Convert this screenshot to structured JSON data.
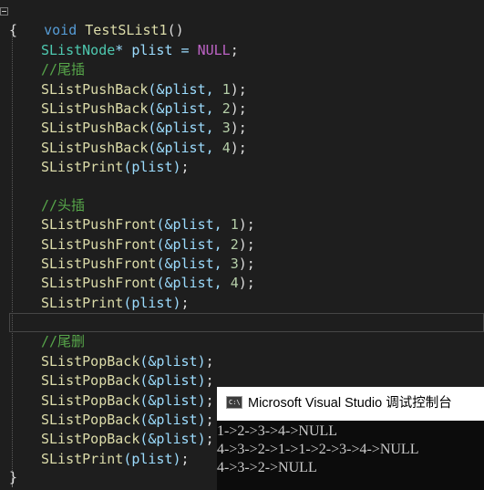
{
  "editor": {
    "function_decl": {
      "keyword": "void",
      "name": "TestSList1",
      "parens": "()"
    },
    "open_brace": "{",
    "close_brace": "}",
    "decl": {
      "type": "SListNode",
      "rest": "* plist = ",
      "value": "NULL",
      "semi": ";"
    },
    "comment_tail": "//尾插",
    "comment_head": "//头插",
    "comment_tail_del": "//尾删",
    "push_back_fn": "SListPushBack",
    "push_front_fn": "SListPushFront",
    "pop_back_fn": "SListPopBack",
    "print_fn": "SListPrint",
    "arg_ref": "(&plist, ",
    "arg_ref_only": "(&plist)",
    "arg_plain": "(plist)",
    "close_call": ");",
    "semi": ";",
    "push_values": [
      "1",
      "2",
      "3",
      "4"
    ]
  },
  "console": {
    "icon_label": "C:\\",
    "title": "Microsoft Visual Studio 调试控制台",
    "output_lines": [
      "1->2->3->4->NULL",
      "4->3->2->1->1->2->3->4->NULL",
      "4->3->2->NULL"
    ]
  },
  "colors": {
    "editor_bg": "#1e1e1e",
    "keyword": "#569cd6",
    "function": "#dcdcaa",
    "type": "#4ec9b0",
    "variable": "#9cdcfe",
    "number": "#b5cea8",
    "macro": "#bd63c5",
    "comment": "#57a64a",
    "console_bg": "#0c0c0c",
    "console_title_bg": "#ffffff"
  }
}
